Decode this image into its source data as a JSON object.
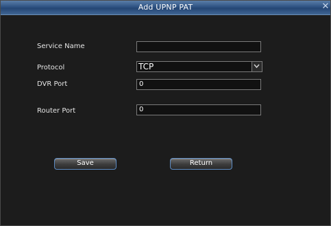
{
  "dialog": {
    "title": "Add UPNP PAT",
    "close_icon": "close-icon"
  },
  "form": {
    "service_name": {
      "label": "Service Name",
      "value": ""
    },
    "protocol": {
      "label": "Protocol",
      "value": "TCP",
      "arrow_icon": "chevron-down-icon"
    },
    "dvr_port": {
      "label": "DVR Port",
      "value": "0"
    },
    "router_port": {
      "label": "Router Port",
      "value": "0"
    }
  },
  "buttons": {
    "save": "Save",
    "return": "Return"
  },
  "colors": {
    "titlebar": "#2f5383",
    "background": "#1c1c1c",
    "button_border": "#5d8cc4"
  }
}
